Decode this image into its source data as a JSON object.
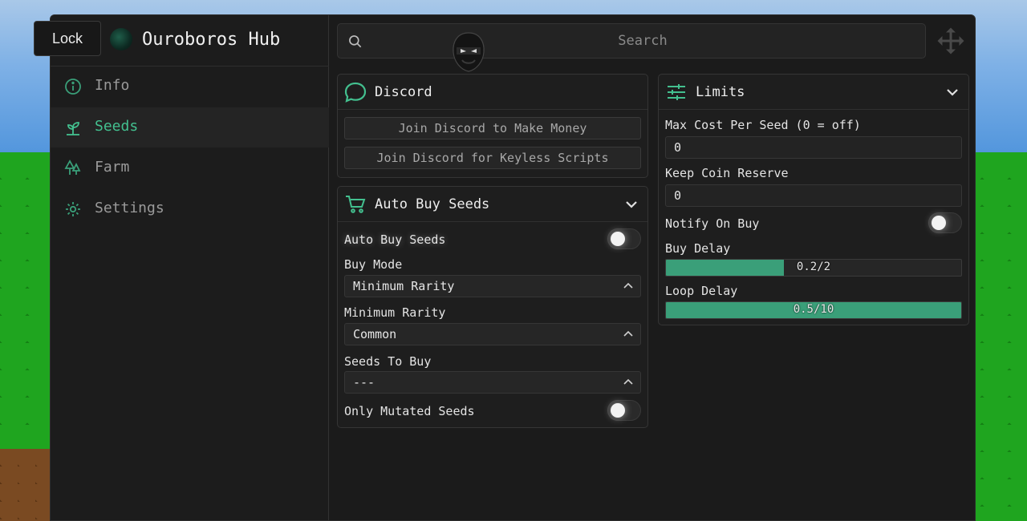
{
  "app": {
    "title": "Ouroboros Hub",
    "lock_label": "Lock"
  },
  "sidebar": {
    "items": [
      {
        "label": "Info",
        "icon": "info-icon",
        "active": false
      },
      {
        "label": "Seeds",
        "icon": "sprout-icon",
        "active": true
      },
      {
        "label": "Farm",
        "icon": "trees-icon",
        "active": false
      },
      {
        "label": "Settings",
        "icon": "gear-icon",
        "active": false
      }
    ]
  },
  "search": {
    "placeholder": "Search",
    "value": ""
  },
  "discord": {
    "title": "Discord",
    "buttons": [
      "Join Discord to Make Money",
      "Join Discord for Keyless Scripts"
    ]
  },
  "auto_buy": {
    "title": "Auto Buy Seeds",
    "toggle_label": "Auto Buy Seeds",
    "toggle_on": false,
    "buy_mode_label": "Buy Mode",
    "buy_mode_value": "Minimum Rarity",
    "min_rarity_label": "Minimum Rarity",
    "min_rarity_value": "Common",
    "seeds_label": "Seeds To Buy",
    "seeds_value": "---",
    "mutated_label": "Only Mutated Seeds",
    "mutated_on": false
  },
  "limits": {
    "title": "Limits",
    "max_cost_label": "Max Cost Per Seed (0 = off)",
    "max_cost_value": "0",
    "reserve_label": "Keep Coin Reserve",
    "reserve_value": "0",
    "notify_label": "Notify On Buy",
    "notify_on": false,
    "buy_delay_label": "Buy Delay",
    "buy_delay_text": "0.2/2",
    "buy_delay_fraction": 0.4,
    "loop_delay_label": "Loop Delay",
    "loop_delay_text": "0.5/10",
    "loop_delay_fraction": 1.0
  },
  "colors": {
    "accent": "#43c08f",
    "slider_fill": "#3a9f79",
    "panel": "#1e1e1e",
    "window": "#1b1b1b"
  }
}
